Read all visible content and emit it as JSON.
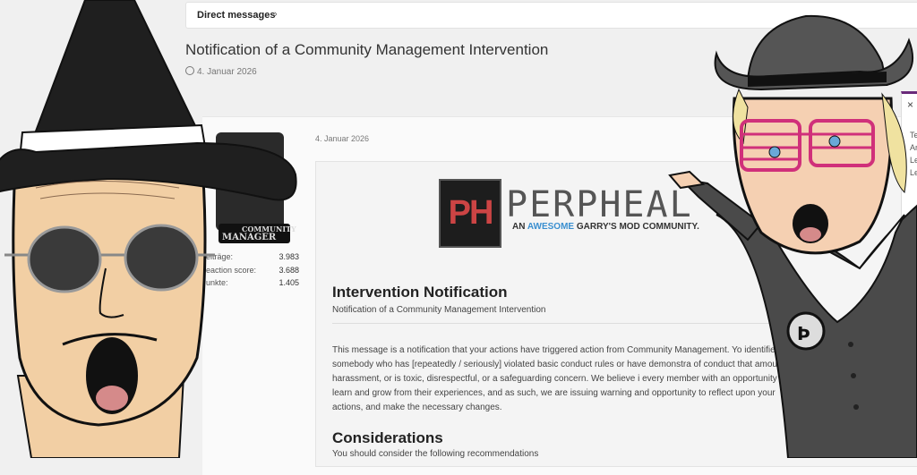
{
  "breadcrumb": {
    "label": "Direct messages",
    "chevron": "›"
  },
  "thread": {
    "title": "Notification of a Community Management Intervention",
    "date": "4. Januar 2026"
  },
  "author": {
    "badge_line1": "COMMUNITY",
    "badge_line2": "MANAGER",
    "stats": [
      {
        "label": "eiträge:",
        "value": "3.983"
      },
      {
        "label": "eaction score:",
        "value": "3.688"
      },
      {
        "label": "unkte:",
        "value": "1.405"
      }
    ]
  },
  "post": {
    "date": "4. Januar 2026",
    "logo_mark": "PH",
    "logo_word": "PERPHEAL",
    "tagline_prefix": "AN ",
    "tagline_accent": "AWESOME",
    "tagline_suffix": " GARRY'S MOD COMMUNITY.",
    "heading": "Intervention Notification",
    "subheading": "Notification of a Community Management Intervention",
    "paragraph": "This message is a notification that your actions have triggered action from Community Management. Yo identified as somebody who has [repeatedly / seriously] violated basic conduct rules or have demonstra of conduct that amounts to harassment, or is toxic, disrespectful, or a safeguarding concern. We believe i every member with an opportunity to learn and grow from their experiences, and as such, we are issuing warning and opportunity to reflect upon your actions, and make the necessary changes.",
    "heading2": "Considerations",
    "subheading2": "You should consider the following recommendations"
  },
  "side_panel": {
    "close": "×",
    "lines": [
      "Te",
      "Ar",
      "Le",
      "Le"
    ]
  },
  "colors": {
    "accent": "#3a8fd0",
    "glasses": "#d0307a",
    "hat": "#1f1f1f",
    "skin": "#f2cfa4"
  }
}
